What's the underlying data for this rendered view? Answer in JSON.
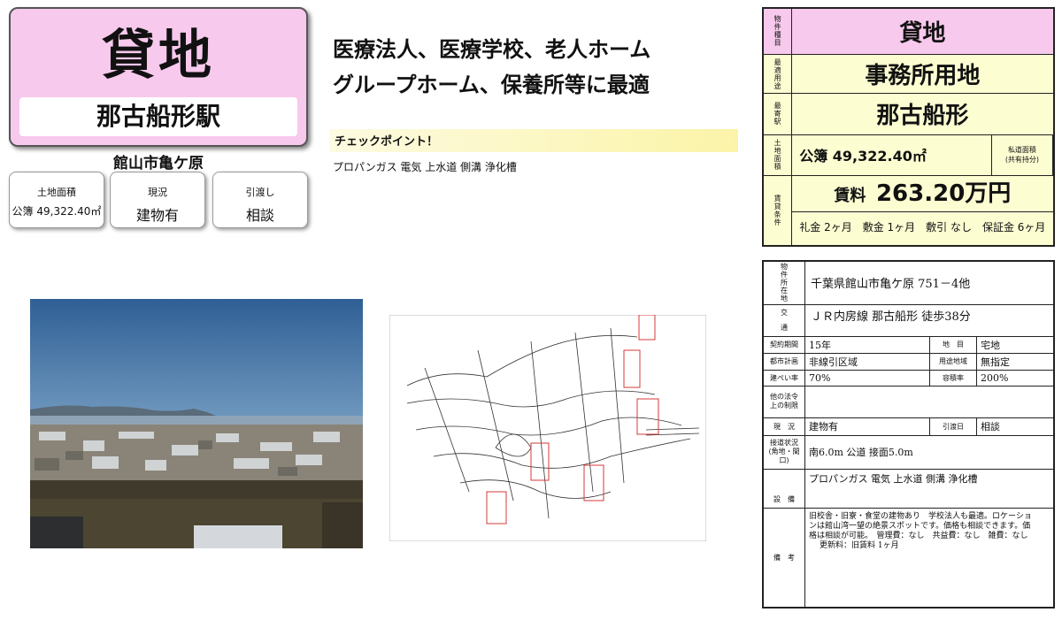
{
  "title_card": {
    "title": "貸地",
    "station": "那古船形駅",
    "city": "館山市亀ケ原"
  },
  "info_cards": [
    {
      "label": "土地面積",
      "value": "公簿 49,322.40㎡"
    },
    {
      "label": "現況",
      "value": "建物有"
    },
    {
      "label": "引渡し",
      "value": "相談"
    }
  ],
  "headline": {
    "line1": "医療法人、医療学校、老人ホーム",
    "line2": "グループホーム、保養所等に最適"
  },
  "checkpoint": {
    "heading": "チェックポイント！",
    "text": "プロパンガス 電気 上水道 側溝 浄化槽"
  },
  "summary": {
    "type_label": [
      "物",
      "件",
      "種",
      "目"
    ],
    "type_value": "貸地",
    "use_label": [
      "最",
      "適",
      "用",
      "途"
    ],
    "use_value": "事務所用地",
    "station_label": [
      "最",
      "寄",
      "駅"
    ],
    "station_value": "那古船形",
    "area_label": [
      "土",
      "地",
      "面",
      "積"
    ],
    "area_value": "公簿 49,322.40㎡",
    "area_note_1": "私道面積",
    "area_note_2": "(共有持分)",
    "rent_label": [
      "賃",
      "貸",
      "条",
      "件"
    ],
    "rent_prefix": "賃料",
    "rent_value": "263.20万円",
    "conditions": "礼金 2ヶ月　敷金 1ヶ月　敷引 なし　保証金 6ヶ月"
  },
  "details": {
    "address_label": [
      "物",
      "件",
      "所",
      "在",
      "地"
    ],
    "address": "千葉県館山市亀ケ原 751－4他",
    "transport_label": [
      "交",
      "通"
    ],
    "transport": "ＪＲ内房線 那古船形 徒歩38分",
    "contract_label": "契約期間",
    "contract": "15年",
    "land_label": "地　目",
    "land": "宅地",
    "city_plan_label": "都市計画",
    "city_plan": "非線引区域",
    "zone_label": "用途地域",
    "zone": "無指定",
    "bcr_label": "建ぺい率",
    "bcr": "70%",
    "far_label": "容積率",
    "far": "200%",
    "restrict_label_1": "他の法令",
    "restrict_label_2": "上の制限",
    "status_label": "現　況",
    "status": "建物有",
    "handover_label": "引渡日",
    "handover": "相談",
    "road_label_1": "接道状況",
    "road_label_2": "(角地・間口)",
    "road": "南6.0m 公道 接面5.0m",
    "facility_label": "設　備",
    "facility": "プロパンガス 電気 上水道 側溝 浄化槽",
    "remarks_label": "備　考",
    "remarks_1": "旧校舎・旧寮・食堂の建物あり　学校法人も最適。ロケーショ",
    "remarks_2": "ンは館山湾一望の絶景スポットです。価格も相談できます。価",
    "remarks_3": "格は相談が可能。　管理費：なし　共益費：なし　雑費：なし",
    "remarks_4": "更新料：旧賃料 1ヶ月"
  }
}
